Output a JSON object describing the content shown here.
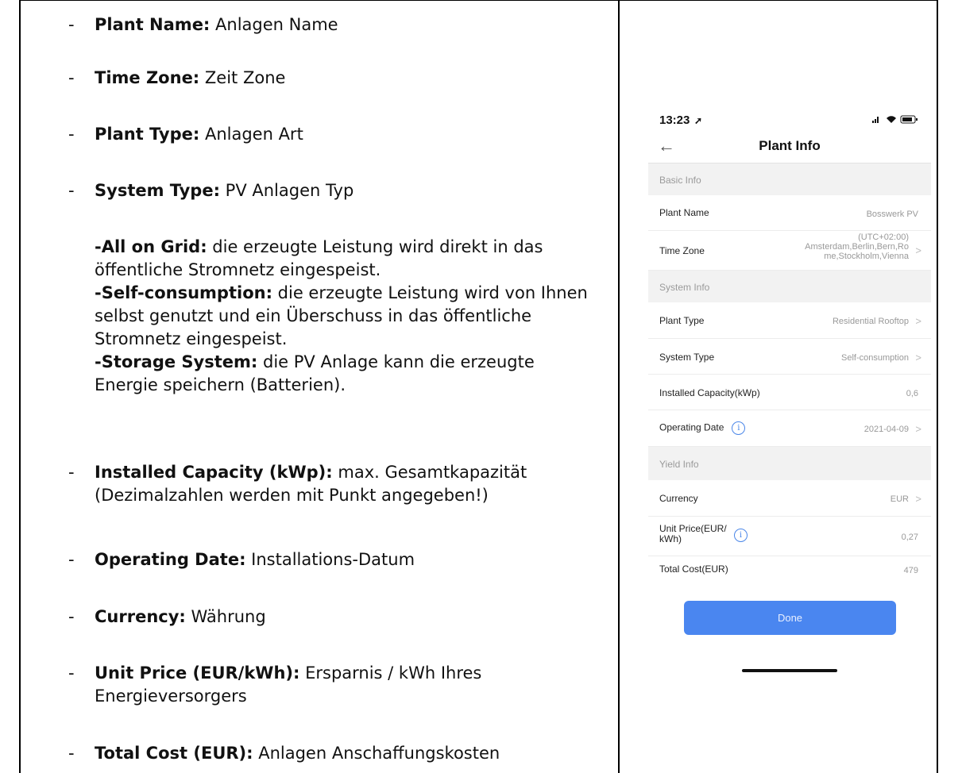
{
  "descriptions": [
    {
      "label": "Plant Name:",
      "text": "Anlagen Name"
    },
    {
      "label": "Time Zone:",
      "text": "Zeit Zone"
    },
    {
      "label": "Plant Type:",
      "text": "Anlagen Art"
    },
    {
      "label": "System Type:",
      "text": "PV Anlagen Typ"
    },
    {
      "label": "Installed Capacity (kWp):",
      "text": "max. Gesamtkapazität (Dezimalzahlen werden mit Punkt angegeben!)"
    },
    {
      "label": "Operating Date:",
      "text": "Installations-Datum"
    },
    {
      "label": "Currency:",
      "text": "Währung"
    },
    {
      "label": "Unit Price (EUR/kWh):",
      "text": "Ersparnis / kWh Ihres Energieversorgers"
    },
    {
      "label": "Total Cost (EUR):",
      "text": "Anlagen Anschaffungskosten"
    }
  ],
  "system_types": [
    {
      "label": "-All on Grid:",
      "text": "die erzeugte Leistung wird direkt in das öffentliche Stromnetz eingespeist."
    },
    {
      "label": "-Self-consumption:",
      "text": "die erzeugte Leistung wird von Ihnen selbst genutzt und ein Überschuss in das öffentliche Stromnetz eingespeist."
    },
    {
      "label": "-Storage System:",
      "text": "die PV Anlage kann die erzeugte Energie speichern (Batterien)."
    }
  ],
  "bullet": "-",
  "phone": {
    "time": "13:23",
    "title": "Plant Info",
    "sections": [
      "Basic Info",
      "System Info",
      "Yield Info"
    ],
    "rows": {
      "plant_name": {
        "label": "Plant Name",
        "value": "Bosswerk PV"
      },
      "time_zone": {
        "label": "Time Zone",
        "value_line1": "(UTC+02:00)",
        "value_line2": "Amsterdam,Berlin,Bern,Ro",
        "value_line3": "me,Stockholm,Vienna"
      },
      "plant_type": {
        "label": "Plant Type",
        "value": "Residential Rooftop"
      },
      "system_type": {
        "label": "System Type",
        "value": "Self-consumption"
      },
      "installed_capacity": {
        "label": "Installed Capacity(kWp)",
        "value": "0,6"
      },
      "operating_date": {
        "label": "Operating Date",
        "value": "2021-04-09"
      },
      "currency": {
        "label": "Currency",
        "value": "EUR"
      },
      "unit_price": {
        "label_line1": "Unit Price(EUR/",
        "label_line2": "kWh)",
        "value": "0,27"
      },
      "total_cost": {
        "label": "Total Cost(EUR)",
        "value": "479"
      }
    },
    "done_label": "Done",
    "info_glyph": "i",
    "back_icon": "←",
    "chevron": ">",
    "colors": {
      "accent": "#4a86f0",
      "section_bg": "#f2f2f2"
    }
  }
}
